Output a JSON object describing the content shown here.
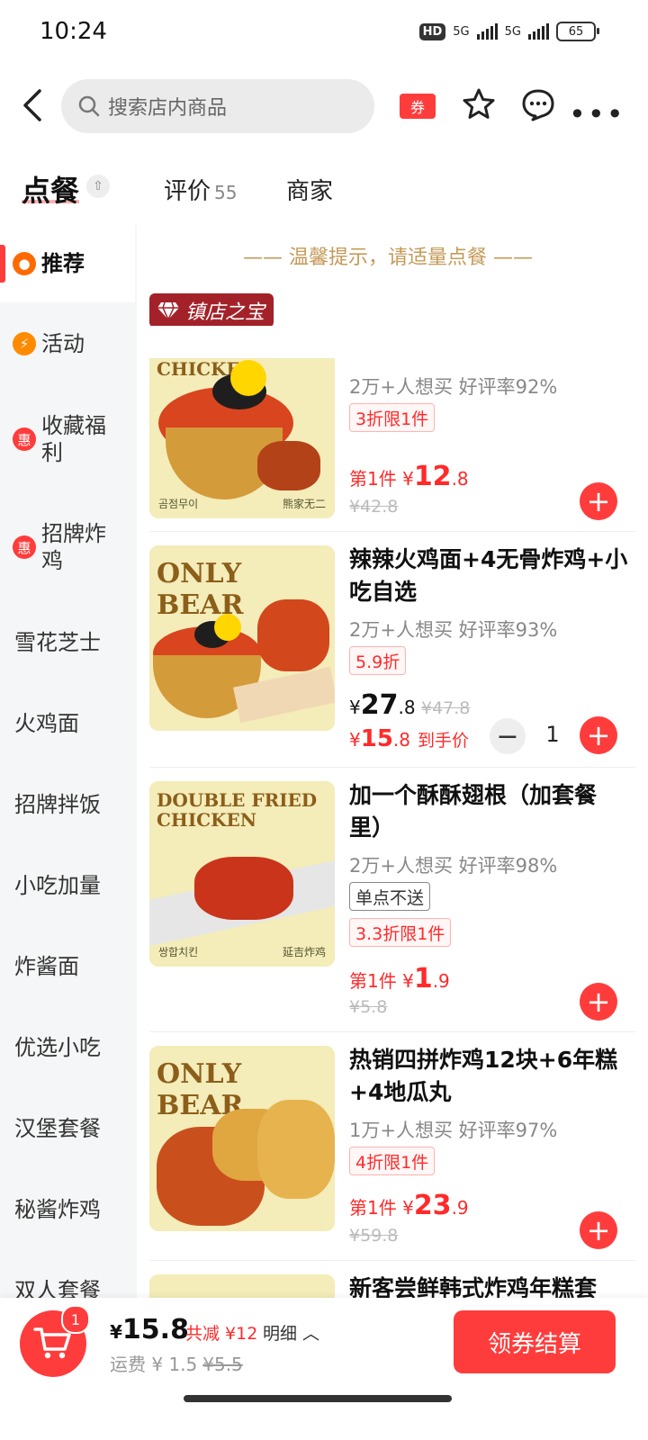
{
  "status": {
    "time": "10:24",
    "net": "HD",
    "sim1": "5G",
    "sim2": "5G",
    "battery": "65"
  },
  "header": {
    "search_placeholder": "搜索店内商品",
    "coupon_label": "券"
  },
  "tabs": {
    "order": "点餐",
    "toggle": "⇧",
    "review": "评价",
    "review_count": "55",
    "merchant": "商家"
  },
  "sidebar": {
    "items": [
      {
        "label": "推荐",
        "badge": "●"
      },
      {
        "label": "活动",
        "badge": "⚡"
      },
      {
        "label": "收藏福利",
        "badge": "惠"
      },
      {
        "label": "招牌炸鸡",
        "badge": "惠"
      },
      {
        "label": "雪花芝士"
      },
      {
        "label": "火鸡面"
      },
      {
        "label": "招牌拌饭"
      },
      {
        "label": "小吃加量"
      },
      {
        "label": "炸酱面"
      },
      {
        "label": "优选小吃"
      },
      {
        "label": "汉堡套餐"
      },
      {
        "label": "秘酱炸鸡"
      },
      {
        "label": "双人套餐"
      }
    ]
  },
  "main": {
    "tip": "—— 温馨提示，请适量点餐 ——",
    "treasure": "镇店之宝",
    "products": [
      {
        "brand": "CHICKEN",
        "stats": "2万+人想买 好评率92%",
        "tag": "3折限1件",
        "price_prefix": "第1件 ¥",
        "price_int": "12",
        "price_dec": ".8",
        "orig": "¥42.8",
        "img_caption_left": "곰점무이",
        "img_caption_right": "熊家无二"
      },
      {
        "brand": "ONLY BEAR",
        "title": "辣辣火鸡面+4无骨炸鸡+小吃自选",
        "stats": "2万+人想买 好评率93%",
        "tag": "5.9折",
        "price_y": "¥",
        "price_int": "27",
        "price_dec": ".8",
        "orig": "¥47.8",
        "final_y": "¥",
        "final_int": "15",
        "final_dec": ".8",
        "final_label": "到手价",
        "qty": "1"
      },
      {
        "brand": "DOUBLE FRIED CHICKEN",
        "title": "加一个酥酥翅根（加套餐里）",
        "stats": "2万+人想买 好评率98%",
        "tag_gray": "单点不送",
        "tag": "3.3折限1件",
        "price_prefix": "第1件 ¥",
        "price_int": "1",
        "price_dec": ".9",
        "orig": "¥5.8",
        "img_caption_left": "쌍합치킨",
        "img_caption_right": "延吉炸鸡"
      },
      {
        "brand": "ONLY BEAR",
        "title": "热销四拼炸鸡12块+6年糕+4地瓜丸",
        "stats": "1万+人想买 好评率97%",
        "tag": "4折限1件",
        "price_prefix": "第1件 ¥",
        "price_int": "23",
        "price_dec": ".9",
        "orig": "¥59.8"
      },
      {
        "title": "新客尝鲜韩式炸鸡年糕套"
      }
    ]
  },
  "bottom": {
    "cart_count": "1",
    "total_y": "¥",
    "total": "15.8",
    "saved": "共减 ¥12",
    "detail": "明细 ︿",
    "fee_label": "运费 ¥ 1.5",
    "fee_orig": "¥5.5",
    "checkout": "领券结算"
  },
  "colors": {
    "accent": "#ff3c3c",
    "treasure": "#a3222a",
    "tip": "#c59a58"
  }
}
